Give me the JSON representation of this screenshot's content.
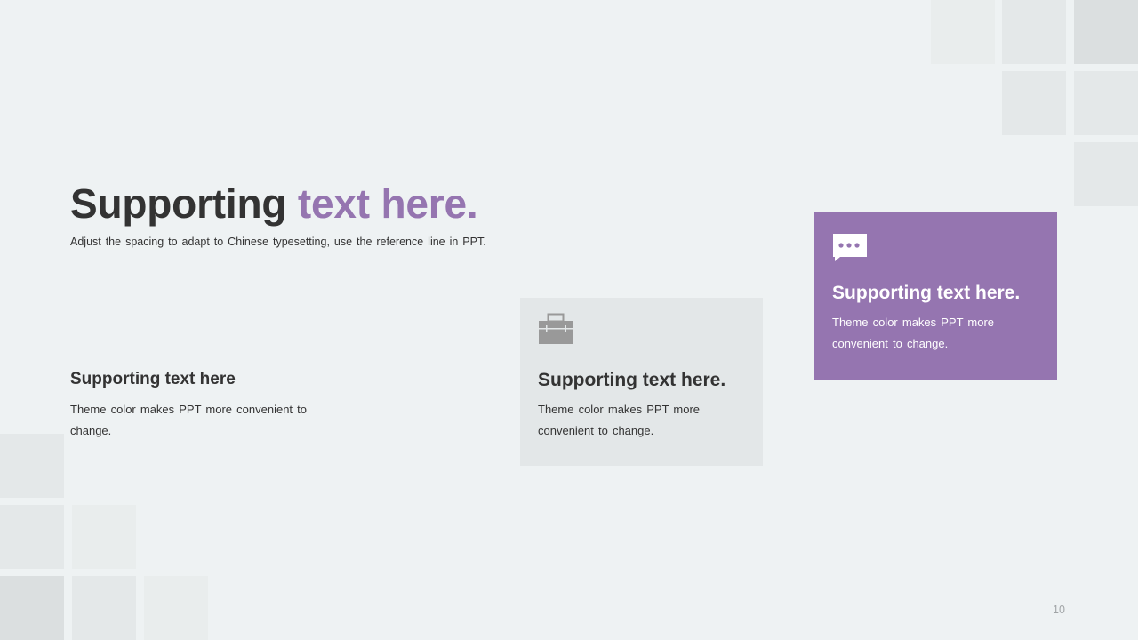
{
  "slide": {
    "title_main": "Supporting",
    "title_accent": "text here.",
    "subtitle": "Adjust the spacing to adapt to Chinese typesetting, use the reference line in PPT.",
    "page_number": "10"
  },
  "cards": [
    {
      "title": "Supporting text here",
      "text": "Theme color makes PPT more convenient to change.",
      "icon": "none"
    },
    {
      "title": "Supporting text here.",
      "text": "Theme color makes PPT more convenient  to change.",
      "icon": "briefcase-icon"
    },
    {
      "title": "Supporting text here.",
      "text": "Theme color makes PPT more convenient  to change.",
      "icon": "speech-bubble-icon"
    }
  ],
  "colors": {
    "background": "#eef2f3",
    "accent": "#9575b0",
    "text": "#333333",
    "gray_card": "#e3e7e8",
    "icon_gray": "#999999",
    "page_number": "#a0a4a6"
  }
}
